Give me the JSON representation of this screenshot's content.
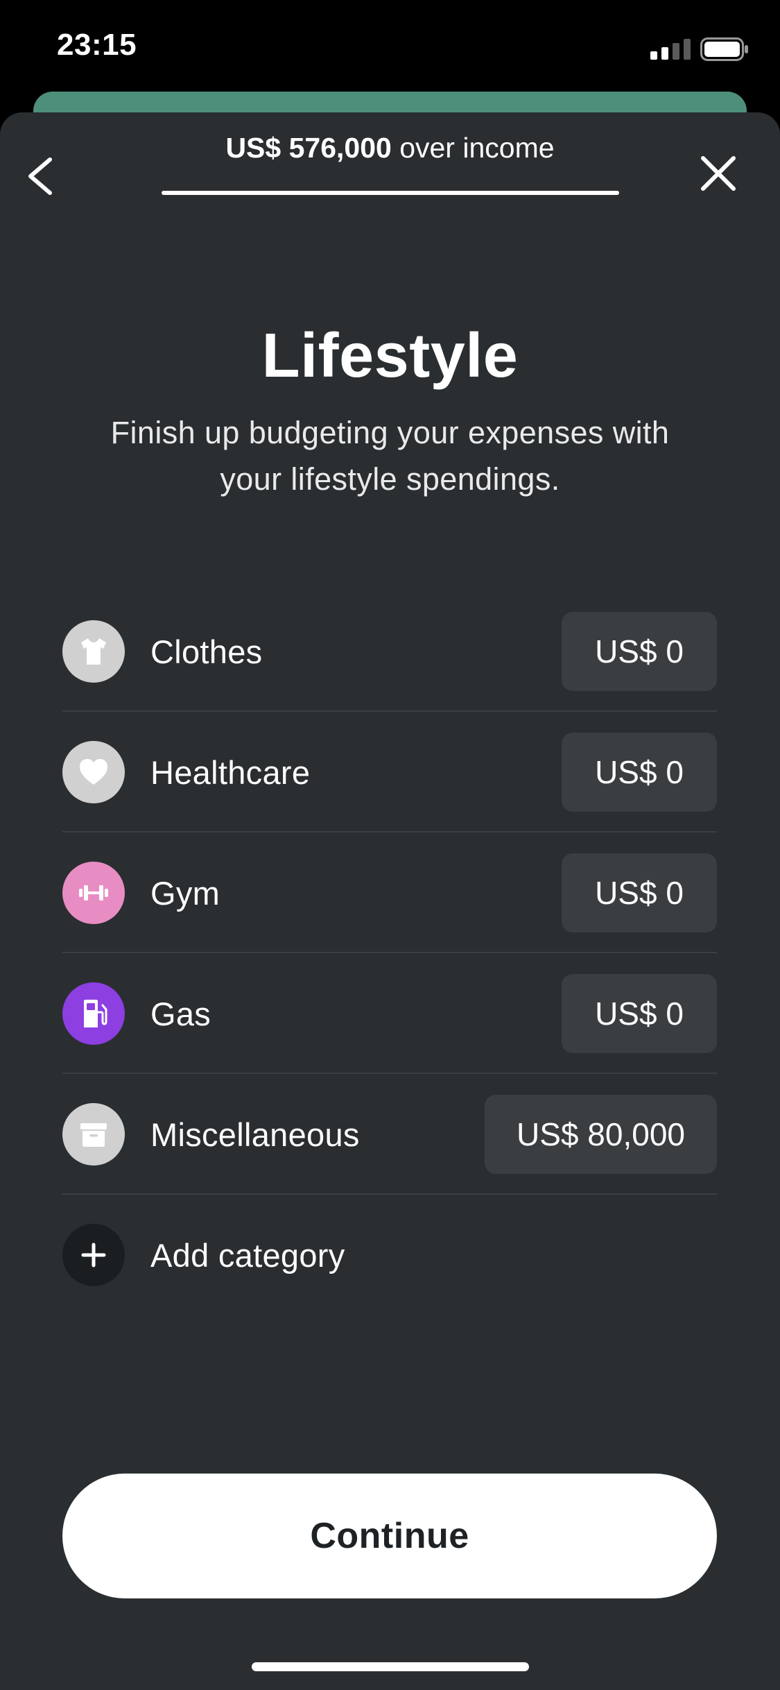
{
  "status_bar": {
    "time": "23:15",
    "icons": [
      "cellular-signal-icon",
      "battery-icon"
    ]
  },
  "header": {
    "over_income_amount": "US$ 576,000",
    "over_income_suffix": " over income",
    "progress_fraction": 1.0,
    "back_icon": "chevron-left-icon",
    "close_icon": "close-icon"
  },
  "page": {
    "title": "Lifestyle",
    "subtitle": "Finish up budgeting your expenses with your lifestyle spendings."
  },
  "categories": [
    {
      "label": "Clothes",
      "amount": "US$ 0",
      "icon": "tshirt-icon",
      "icon_bg": "#d0d0d0"
    },
    {
      "label": "Healthcare",
      "amount": "US$ 0",
      "icon": "heart-icon",
      "icon_bg": "#d0d0d0"
    },
    {
      "label": "Gym",
      "amount": "US$ 0",
      "icon": "dumbbell-icon",
      "icon_bg": "#e88dc4"
    },
    {
      "label": "Gas",
      "amount": "US$ 0",
      "icon": "gas-pump-icon",
      "icon_bg": "#8d3fe2"
    },
    {
      "label": "Miscellaneous",
      "amount": "US$ 80,000",
      "icon": "archive-box-icon",
      "icon_bg": "#d0d0d0"
    }
  ],
  "add_category": {
    "label": "Add category",
    "icon": "plus-icon",
    "icon_bg": "#1b1e20"
  },
  "footer": {
    "continue_label": "Continue"
  },
  "colors": {
    "background": "#000000",
    "sheet": "#2a2e31",
    "peek_card": "#4e8f7b",
    "amount_pill": "#3a3e41",
    "button": "#ffffff"
  }
}
